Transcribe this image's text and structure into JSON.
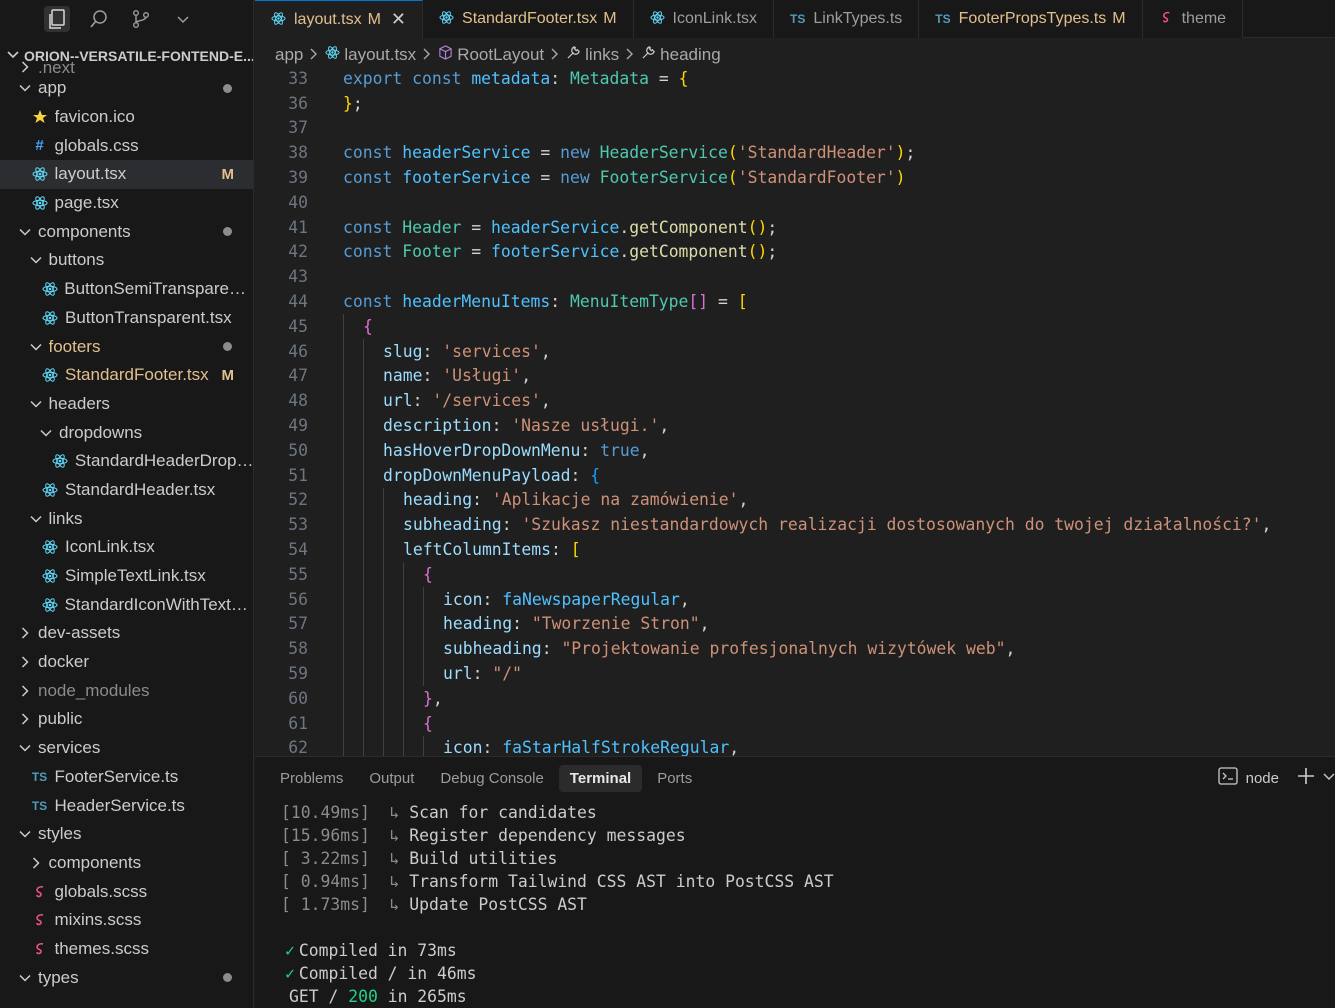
{
  "colors": {
    "modified": "#e2c08d",
    "accent": "#0078d4",
    "react_icon": "#61dafb",
    "ts_icon": "#519aba",
    "sass_icon": "#f55385",
    "css_icon": "#42a5f5",
    "star_icon": "#f5d442"
  },
  "sidebar": {
    "root_title": "ORION--VERSATILE-FONTEND-E...",
    "toolbar_icons": [
      "explorer-icon",
      "search-icon",
      "source-control-icon",
      "chevron-down-icon"
    ],
    "items": [
      {
        "label": ".next",
        "indent": 1,
        "kind": "folder",
        "open": false,
        "icon": "chevron-right-icon",
        "muted": true
      },
      {
        "label": "app",
        "indent": 1,
        "kind": "folder",
        "open": true,
        "dot": true
      },
      {
        "label": "favicon.ico",
        "indent": 2,
        "kind": "file",
        "icon": "star-icon"
      },
      {
        "label": "globals.css",
        "indent": 2,
        "kind": "file",
        "icon": "hash-icon"
      },
      {
        "label": "layout.tsx",
        "indent": 2,
        "kind": "file",
        "icon": "react-icon",
        "badge": "M",
        "selected": true
      },
      {
        "label": "page.tsx",
        "indent": 2,
        "kind": "file",
        "icon": "react-icon"
      },
      {
        "label": "components",
        "indent": 1,
        "kind": "folder",
        "open": true,
        "dot": true
      },
      {
        "label": "buttons",
        "indent": 2,
        "kind": "folder",
        "open": true
      },
      {
        "label": "ButtonSemiTransparent....",
        "indent": 3,
        "kind": "file",
        "icon": "react-icon"
      },
      {
        "label": "ButtonTransparent.tsx",
        "indent": 3,
        "kind": "file",
        "icon": "react-icon"
      },
      {
        "label": "footers",
        "indent": 2,
        "kind": "folder",
        "open": true,
        "dot": true,
        "modified": true
      },
      {
        "label": "StandardFooter.tsx",
        "indent": 3,
        "kind": "file",
        "icon": "react-icon",
        "badge": "M",
        "modified": true
      },
      {
        "label": "headers",
        "indent": 2,
        "kind": "folder",
        "open": true
      },
      {
        "label": "dropdowns",
        "indent": 3,
        "kind": "folder",
        "open": true
      },
      {
        "label": "StandardHeaderDropd...",
        "indent": 4,
        "kind": "file",
        "icon": "react-icon"
      },
      {
        "label": "StandardHeader.tsx",
        "indent": 3,
        "kind": "file",
        "icon": "react-icon"
      },
      {
        "label": "links",
        "indent": 2,
        "kind": "folder",
        "open": true
      },
      {
        "label": "IconLink.tsx",
        "indent": 3,
        "kind": "file",
        "icon": "react-icon"
      },
      {
        "label": "SimpleTextLink.tsx",
        "indent": 3,
        "kind": "file",
        "icon": "react-icon"
      },
      {
        "label": "StandardIconWithTextLi...",
        "indent": 3,
        "kind": "file",
        "icon": "react-icon"
      },
      {
        "label": "dev-assets",
        "indent": 1,
        "kind": "folder",
        "open": false
      },
      {
        "label": "docker",
        "indent": 1,
        "kind": "folder",
        "open": false
      },
      {
        "label": "node_modules",
        "indent": 1,
        "kind": "folder",
        "open": false,
        "muted": true
      },
      {
        "label": "public",
        "indent": 1,
        "kind": "folder",
        "open": false
      },
      {
        "label": "services",
        "indent": 1,
        "kind": "folder",
        "open": true
      },
      {
        "label": "FooterService.ts",
        "indent": 2,
        "kind": "file",
        "icon": "ts-icon"
      },
      {
        "label": "HeaderService.ts",
        "indent": 2,
        "kind": "file",
        "icon": "ts-icon"
      },
      {
        "label": "styles",
        "indent": 1,
        "kind": "folder",
        "open": true
      },
      {
        "label": "components",
        "indent": 2,
        "kind": "folder",
        "open": false
      },
      {
        "label": "globals.scss",
        "indent": 2,
        "kind": "file",
        "icon": "sass-icon"
      },
      {
        "label": "mixins.scss",
        "indent": 2,
        "kind": "file",
        "icon": "sass-icon"
      },
      {
        "label": "themes.scss",
        "indent": 2,
        "kind": "file",
        "icon": "sass-icon"
      },
      {
        "label": "types",
        "indent": 1,
        "kind": "folder",
        "open": true,
        "dot": true
      }
    ]
  },
  "editor": {
    "tabs": [
      {
        "label": "layout.tsx",
        "icon": "react-icon",
        "badge": "M",
        "active": true,
        "close": "✕",
        "modified": true
      },
      {
        "label": "StandardFooter.tsx",
        "icon": "react-icon",
        "badge": "M",
        "modified": true
      },
      {
        "label": "IconLink.tsx",
        "icon": "react-icon"
      },
      {
        "label": "LinkTypes.ts",
        "icon": "ts-icon"
      },
      {
        "label": "FooterPropsTypes.ts",
        "icon": "ts-icon",
        "badge": "M",
        "modified": true
      },
      {
        "label": "theme",
        "icon": "sass-icon"
      }
    ],
    "breadcrumbs": [
      {
        "label": "app",
        "icon": ""
      },
      {
        "label": "layout.tsx",
        "icon": "react-icon"
      },
      {
        "label": "RootLayout",
        "icon": "cube-icon"
      },
      {
        "label": "links",
        "icon": "wrench-icon"
      },
      {
        "label": "heading",
        "icon": "wrench-icon"
      }
    ],
    "lines": [
      {
        "n": "33",
        "guides": 0,
        "tokens": [
          [
            "k",
            "export"
          ],
          [
            "w",
            " "
          ],
          [
            "k",
            "const"
          ],
          [
            "w",
            " "
          ],
          [
            "v",
            "metadata"
          ],
          [
            "w",
            ": "
          ],
          [
            "t",
            "Metadata"
          ],
          [
            "w",
            " = "
          ],
          [
            "y",
            "{"
          ]
        ]
      },
      {
        "n": "36",
        "guides": 0,
        "tokens": [
          [
            "y",
            "}"
          ],
          [
            "w",
            ";"
          ]
        ]
      },
      {
        "n": "37",
        "guides": 0,
        "tokens": []
      },
      {
        "n": "38",
        "guides": 0,
        "tokens": [
          [
            "k",
            "const"
          ],
          [
            "w",
            " "
          ],
          [
            "v",
            "headerService"
          ],
          [
            "w",
            " = "
          ],
          [
            "k",
            "new"
          ],
          [
            "w",
            " "
          ],
          [
            "t",
            "HeaderService"
          ],
          [
            "y",
            "("
          ],
          [
            "s",
            "'StandardHeader'"
          ],
          [
            "y",
            ")"
          ],
          [
            "w",
            ";"
          ]
        ]
      },
      {
        "n": "39",
        "guides": 0,
        "tokens": [
          [
            "k",
            "const"
          ],
          [
            "w",
            " "
          ],
          [
            "v",
            "footerService"
          ],
          [
            "w",
            " = "
          ],
          [
            "k",
            "new"
          ],
          [
            "w",
            " "
          ],
          [
            "t",
            "FooterService"
          ],
          [
            "y",
            "("
          ],
          [
            "s",
            "'StandardFooter'"
          ],
          [
            "y",
            ")"
          ]
        ]
      },
      {
        "n": "40",
        "guides": 0,
        "tokens": []
      },
      {
        "n": "41",
        "guides": 0,
        "tokens": [
          [
            "k",
            "const"
          ],
          [
            "w",
            " "
          ],
          [
            "t",
            "Header"
          ],
          [
            "w",
            " = "
          ],
          [
            "v",
            "headerService"
          ],
          [
            "w",
            "."
          ],
          [
            "f",
            "getComponent"
          ],
          [
            "y",
            "()"
          ],
          [
            "w",
            ";"
          ]
        ]
      },
      {
        "n": "42",
        "guides": 0,
        "tokens": [
          [
            "k",
            "const"
          ],
          [
            "w",
            " "
          ],
          [
            "t",
            "Footer"
          ],
          [
            "w",
            " = "
          ],
          [
            "v",
            "footerService"
          ],
          [
            "w",
            "."
          ],
          [
            "f",
            "getComponent"
          ],
          [
            "y",
            "()"
          ],
          [
            "w",
            ";"
          ]
        ]
      },
      {
        "n": "43",
        "guides": 0,
        "tokens": []
      },
      {
        "n": "44",
        "guides": 0,
        "tokens": [
          [
            "k",
            "const"
          ],
          [
            "w",
            " "
          ],
          [
            "v",
            "headerMenuItems"
          ],
          [
            "w",
            ": "
          ],
          [
            "t",
            "MenuItemType"
          ],
          [
            "m",
            "[]"
          ],
          [
            "w",
            " = "
          ],
          [
            "y",
            "["
          ]
        ]
      },
      {
        "n": "45",
        "guides": 1,
        "tokens": [
          [
            "m",
            "{"
          ]
        ]
      },
      {
        "n": "46",
        "guides": 2,
        "tokens": [
          [
            "p",
            "slug"
          ],
          [
            "w",
            ": "
          ],
          [
            "s",
            "'services'"
          ],
          [
            "w",
            ","
          ]
        ]
      },
      {
        "n": "47",
        "guides": 2,
        "tokens": [
          [
            "p",
            "name"
          ],
          [
            "w",
            ": "
          ],
          [
            "s",
            "'Usługi'"
          ],
          [
            "w",
            ","
          ]
        ]
      },
      {
        "n": "48",
        "guides": 2,
        "tokens": [
          [
            "p",
            "url"
          ],
          [
            "w",
            ": "
          ],
          [
            "s",
            "'/services'"
          ],
          [
            "w",
            ","
          ]
        ]
      },
      {
        "n": "49",
        "guides": 2,
        "tokens": [
          [
            "p",
            "description"
          ],
          [
            "w",
            ": "
          ],
          [
            "s",
            "'Nasze usługi.'"
          ],
          [
            "w",
            ","
          ]
        ]
      },
      {
        "n": "50",
        "guides": 2,
        "tokens": [
          [
            "p",
            "hasHoverDropDownMenu"
          ],
          [
            "w",
            ": "
          ],
          [
            "k",
            "true"
          ],
          [
            "w",
            ","
          ]
        ]
      },
      {
        "n": "51",
        "guides": 2,
        "tokens": [
          [
            "p",
            "dropDownMenuPayload"
          ],
          [
            "w",
            ": "
          ],
          [
            "b",
            "{"
          ]
        ]
      },
      {
        "n": "52",
        "guides": 3,
        "tokens": [
          [
            "p",
            "heading"
          ],
          [
            "w",
            ": "
          ],
          [
            "s",
            "'Aplikacje na zamówienie'"
          ],
          [
            "w",
            ","
          ]
        ]
      },
      {
        "n": "53",
        "guides": 3,
        "tokens": [
          [
            "p",
            "subheading"
          ],
          [
            "w",
            ": "
          ],
          [
            "s",
            "'Szukasz niestandardowych realizacji dostosowanych do twojej działalności?'"
          ],
          [
            "w",
            ","
          ]
        ]
      },
      {
        "n": "54",
        "guides": 3,
        "tokens": [
          [
            "p",
            "leftColumnItems"
          ],
          [
            "w",
            ": "
          ],
          [
            "y",
            "["
          ]
        ]
      },
      {
        "n": "55",
        "guides": 4,
        "tokens": [
          [
            "m",
            "{"
          ]
        ]
      },
      {
        "n": "56",
        "guides": 5,
        "tokens": [
          [
            "p",
            "icon"
          ],
          [
            "w",
            ": "
          ],
          [
            "v",
            "faNewspaperRegular"
          ],
          [
            "w",
            ","
          ]
        ]
      },
      {
        "n": "57",
        "guides": 5,
        "tokens": [
          [
            "p",
            "heading"
          ],
          [
            "w",
            ": "
          ],
          [
            "s",
            "\"Tworzenie Stron\""
          ],
          [
            "w",
            ","
          ]
        ]
      },
      {
        "n": "58",
        "guides": 5,
        "tokens": [
          [
            "p",
            "subheading"
          ],
          [
            "w",
            ": "
          ],
          [
            "s",
            "\"Projektowanie profesjonalnych wizytówek web\""
          ],
          [
            "w",
            ","
          ]
        ]
      },
      {
        "n": "59",
        "guides": 5,
        "tokens": [
          [
            "p",
            "url"
          ],
          [
            "w",
            ": "
          ],
          [
            "s",
            "\"/\""
          ]
        ]
      },
      {
        "n": "60",
        "guides": 4,
        "tokens": [
          [
            "m",
            "}"
          ],
          [
            "w",
            ","
          ]
        ]
      },
      {
        "n": "61",
        "guides": 4,
        "tokens": [
          [
            "m",
            "{"
          ]
        ]
      },
      {
        "n": "62",
        "guides": 5,
        "tokens": [
          [
            "p",
            "icon"
          ],
          [
            "w",
            ": "
          ],
          [
            "v",
            "faStarHalfStrokeRegular"
          ],
          [
            "w",
            ","
          ]
        ]
      }
    ]
  },
  "panel": {
    "tabs": [
      {
        "label": "Problems"
      },
      {
        "label": "Output"
      },
      {
        "label": "Debug Console"
      },
      {
        "label": "Terminal",
        "active": true
      },
      {
        "label": "Ports"
      }
    ],
    "terminal_name": "node",
    "terminal_lines": [
      {
        "time": "[10.49ms]",
        "text": "Scan for candidates"
      },
      {
        "time": "[15.96ms]",
        "text": "Register dependency messages"
      },
      {
        "time": "[ 3.22ms]",
        "text": "Build utilities"
      },
      {
        "time": "[ 0.94ms]",
        "text": "Transform Tailwind CSS AST into PostCSS AST"
      },
      {
        "time": "[ 1.73ms]",
        "text": "Update PostCSS AST"
      }
    ],
    "compiled": [
      {
        "mark": "✓",
        "text": "Compiled in 73ms"
      },
      {
        "mark": "✓",
        "text": "Compiled / in 46ms"
      }
    ],
    "get_line": {
      "prefix": "GET / ",
      "status": "200",
      "suffix": " in 265ms"
    }
  }
}
